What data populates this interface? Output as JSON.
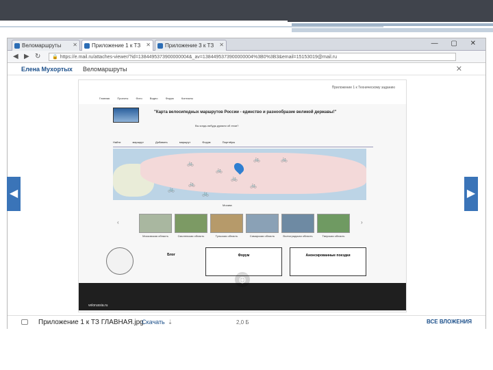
{
  "browser": {
    "tabs": [
      {
        "label": "Веломаршруты"
      },
      {
        "label": "Приложение 1 к ТЗ"
      },
      {
        "label": "Приложение 3 к ТЗ"
      }
    ],
    "window_controls": "— ▢ ✕",
    "url": "https://e.mail.ru/attaches-viewer/?id=1384495373900000004&_av=1384495373900000004%3B0%3B3&email=15153019@mail.ru",
    "back_icon": "back-arrow-icon",
    "forward_icon": "forward-arrow-icon",
    "reload_icon": "reload-icon"
  },
  "mail": {
    "user_name": "Елена Мухортых",
    "subject": "Веломаршруты",
    "close_label": "✕"
  },
  "site": {
    "top_link": "Приложение 1 к Техническому заданию",
    "menu": "Главная Проекты Фото Видео Форум Контакты",
    "title": "\"Карта велосипедных маршрутов России - единство и разнообразие великой державы!\"",
    "question": "Вы когда-нибудь думали об этом?",
    "nav": "Найти маршрут Добавить маршрут Форум Партнёры",
    "map_caption": "Москва",
    "thumbs": [
      {
        "label": "Московская область"
      },
      {
        "label": "Смоленская область"
      },
      {
        "label": "Тульская область"
      },
      {
        "label": "Самарская область"
      },
      {
        "label": "Волгоградская область"
      },
      {
        "label": "Тверская область"
      }
    ],
    "box_blog": "Блог",
    "box_forum": "Форум",
    "box_routes": "Анонсированные поездки",
    "footer_url": "velorussia.ru"
  },
  "attachment": {
    "name": "Приложение 1 к ТЗ ГЛАВНАЯ.jpg",
    "download_label": "Скачать",
    "size": "2,0 Б",
    "all_label": "ВСЕ ВЛОЖЕНИЯ"
  },
  "slide": {
    "left_arrow": "◀",
    "right_arrow": "▶"
  }
}
